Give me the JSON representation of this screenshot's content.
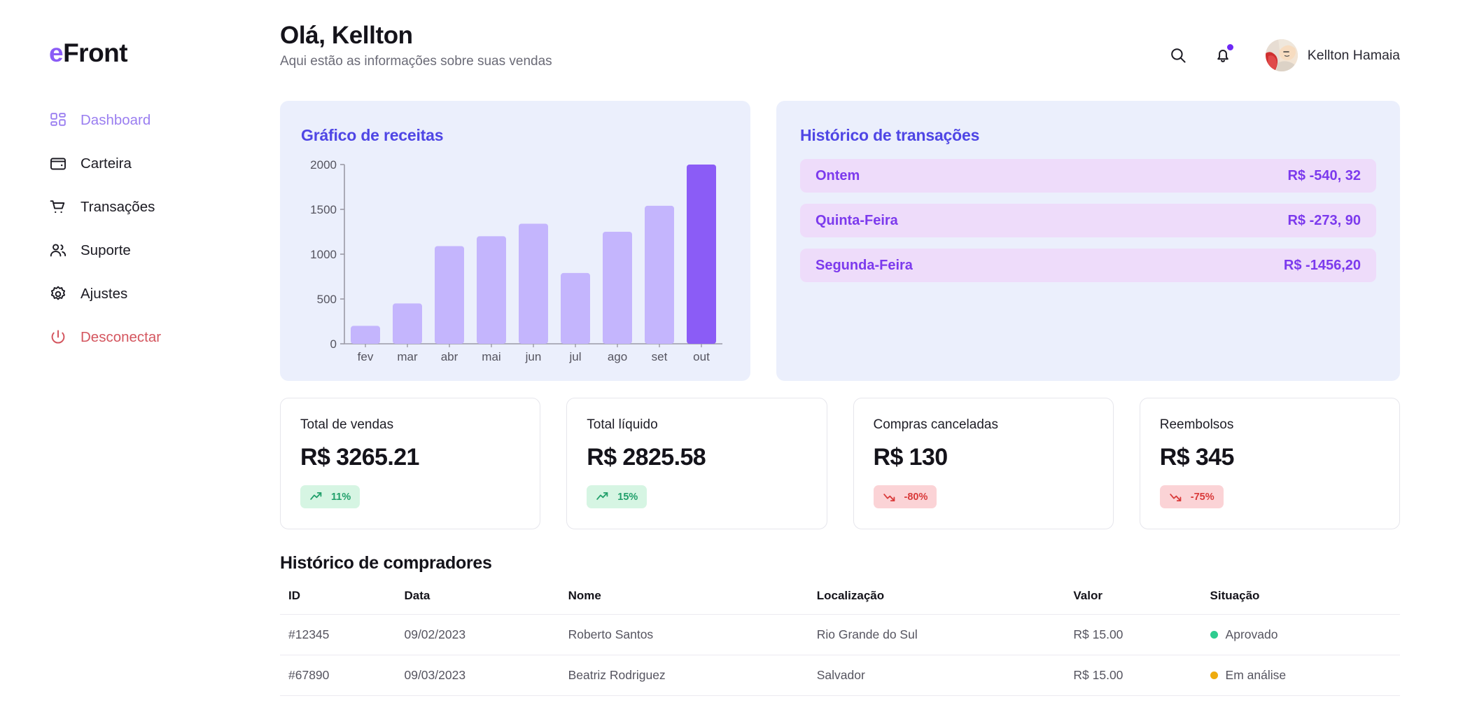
{
  "brand": {
    "prefix": "e",
    "rest": "Front"
  },
  "sidebar": {
    "items": [
      {
        "label": "Dashboard",
        "icon": "grid-icon",
        "state": "active"
      },
      {
        "label": "Carteira",
        "icon": "wallet-icon",
        "state": "normal"
      },
      {
        "label": "Transações",
        "icon": "cart-icon",
        "state": "normal"
      },
      {
        "label": "Suporte",
        "icon": "users-icon",
        "state": "normal"
      },
      {
        "label": "Ajustes",
        "icon": "gear-icon",
        "state": "normal"
      },
      {
        "label": "Desconectar",
        "icon": "power-icon",
        "state": "danger"
      }
    ]
  },
  "header": {
    "title": "Olá, Kellton",
    "subtitle": "Aqui estão as informações sobre suas vendas",
    "search_icon": "search-icon",
    "bell_icon": "bell-icon",
    "has_notification": true,
    "user_name": "Kellton Hamaia"
  },
  "chart_panel": {
    "title": "Gráfico de receitas"
  },
  "chart_data": {
    "type": "bar",
    "title": "Gráfico de receitas",
    "xlabel": "",
    "ylabel": "",
    "categories": [
      "fev",
      "mar",
      "abr",
      "mai",
      "jun",
      "jul",
      "ago",
      "set",
      "out"
    ],
    "values": [
      200,
      450,
      1090,
      1200,
      1340,
      790,
      1250,
      1540,
      2000
    ],
    "highlight_index": 8,
    "ylim": [
      0,
      2000
    ],
    "yticks": [
      0,
      500,
      1000,
      1500,
      2000
    ],
    "ytick_labels": [
      "0",
      "500",
      "1000",
      "1500",
      "2000"
    ],
    "grid": false,
    "legend": null,
    "bar_color": "#c4b5fd",
    "highlight_color": "#8b5cf6"
  },
  "transactions_panel": {
    "title": "Histórico de transações",
    "rows": [
      {
        "day": "Ontem",
        "amount": "R$ -540, 32"
      },
      {
        "day": "Quinta-Feira",
        "amount": "R$ -273, 90"
      },
      {
        "day": "Segunda-Feira",
        "amount": "R$ -1456,20"
      }
    ]
  },
  "stats": [
    {
      "label": "Total de vendas",
      "value": "R$ 3265.21",
      "delta": "11%",
      "trend": "up",
      "icon": "trend-up-icon"
    },
    {
      "label": "Total líquido",
      "value": "R$ 2825.58",
      "delta": "15%",
      "trend": "up",
      "icon": "trend-up-icon"
    },
    {
      "label": "Compras canceladas",
      "value": "R$ 130",
      "delta": "-80%",
      "trend": "down",
      "icon": "trend-down-icon"
    },
    {
      "label": "Reembolsos",
      "value": "R$ 345",
      "delta": "-75%",
      "trend": "down",
      "icon": "trend-down-icon"
    }
  ],
  "table": {
    "title": "Histórico de compradores",
    "columns": [
      "ID",
      "Data",
      "Nome",
      "Localização",
      "Valor",
      "Situação"
    ],
    "rows": [
      {
        "id": "#12345",
        "date": "09/02/2023",
        "name": "Roberto Santos",
        "location": "Rio Grande do Sul",
        "value": "R$ 15.00",
        "status": "Aprovado",
        "status_color": "#2ecc8f"
      },
      {
        "id": "#67890",
        "date": "09/03/2023",
        "name": "Beatriz Rodriguez",
        "location": "Salvador",
        "value": "R$ 15.00",
        "status": "Em análise",
        "status_color": "#eeab0e"
      }
    ]
  },
  "colors": {
    "accent": "#8b5cf6",
    "panel_title": "#4f46e5",
    "panel_bg": "#ebeffc",
    "trans_row_bg": "#eedcfa",
    "trans_text": "#7c3aed",
    "up": "#22a06b",
    "down": "#d93a3a",
    "logout": "#d4565f"
  }
}
